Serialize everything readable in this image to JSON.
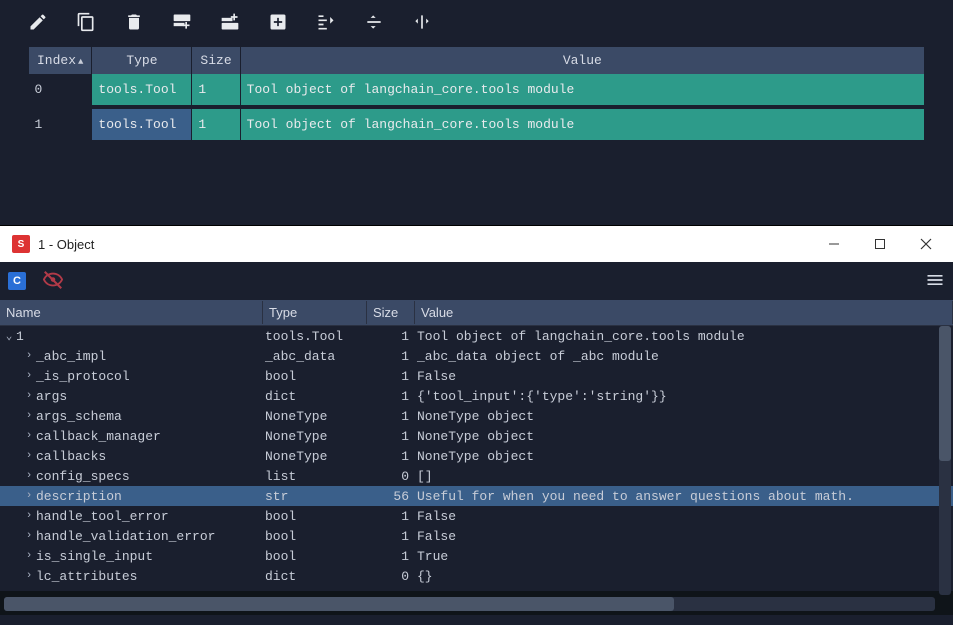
{
  "toolbar_icons": {
    "edit": "edit-icon",
    "copy": "copy-icon",
    "delete": "delete-icon",
    "insert_above": "insert-row-above-icon",
    "insert_below": "insert-row-below-icon",
    "add": "add-icon",
    "collapse": "collapse-icon",
    "hline": "hline-icon",
    "vline": "vline-icon"
  },
  "var_table": {
    "headers": {
      "index": "Index",
      "type": "Type",
      "size": "Size",
      "value": "Value"
    },
    "sort_indicator": "▲",
    "rows": [
      {
        "index": "0",
        "type": "tools.Tool",
        "size": "1",
        "value": "Tool object of langchain_core.tools module",
        "selected": false
      },
      {
        "index": "1",
        "type": "tools.Tool",
        "size": "1",
        "value": "Tool object of langchain_core.tools module",
        "selected": true
      }
    ]
  },
  "inspector": {
    "title": "1 - Object",
    "app_icon_label": "S",
    "c_icon_label": "C",
    "headers": {
      "name": "Name",
      "type": "Type",
      "size": "Size",
      "value": "Value"
    },
    "rows": [
      {
        "depth": 0,
        "twisty": "v",
        "name": "1",
        "type": "tools.Tool",
        "size": "1",
        "value": "Tool object of langchain_core.tools module",
        "selected": false
      },
      {
        "depth": 1,
        "twisty": ">",
        "name": "_abc_impl",
        "type": "_abc_data",
        "size": "1",
        "value": "_abc_data object of _abc module",
        "selected": false
      },
      {
        "depth": 1,
        "twisty": ">",
        "name": "_is_protocol",
        "type": "bool",
        "size": "1",
        "value": "False",
        "selected": false
      },
      {
        "depth": 1,
        "twisty": ">",
        "name": "args",
        "type": "dict",
        "size": "1",
        "value": "{'tool_input':{'type':'string'}}",
        "selected": false
      },
      {
        "depth": 1,
        "twisty": ">",
        "name": "args_schema",
        "type": "NoneType",
        "size": "1",
        "value": "NoneType object",
        "selected": false
      },
      {
        "depth": 1,
        "twisty": ">",
        "name": "callback_manager",
        "type": "NoneType",
        "size": "1",
        "value": "NoneType object",
        "selected": false
      },
      {
        "depth": 1,
        "twisty": ">",
        "name": "callbacks",
        "type": "NoneType",
        "size": "1",
        "value": "NoneType object",
        "selected": false
      },
      {
        "depth": 1,
        "twisty": ">",
        "name": "config_specs",
        "type": "list",
        "size": "0",
        "value": "[]",
        "selected": false
      },
      {
        "depth": 1,
        "twisty": ">",
        "name": "description",
        "type": "str",
        "size": "56",
        "value": "Useful for when you need to answer questions about math.",
        "selected": true
      },
      {
        "depth": 1,
        "twisty": ">",
        "name": "handle_tool_error",
        "type": "bool",
        "size": "1",
        "value": "False",
        "selected": false
      },
      {
        "depth": 1,
        "twisty": ">",
        "name": "handle_validation_error",
        "type": "bool",
        "size": "1",
        "value": "False",
        "selected": false
      },
      {
        "depth": 1,
        "twisty": ">",
        "name": "is_single_input",
        "type": "bool",
        "size": "1",
        "value": "True",
        "selected": false
      },
      {
        "depth": 1,
        "twisty": ">",
        "name": "lc_attributes",
        "type": "dict",
        "size": "0",
        "value": "{}",
        "selected": false
      }
    ]
  }
}
